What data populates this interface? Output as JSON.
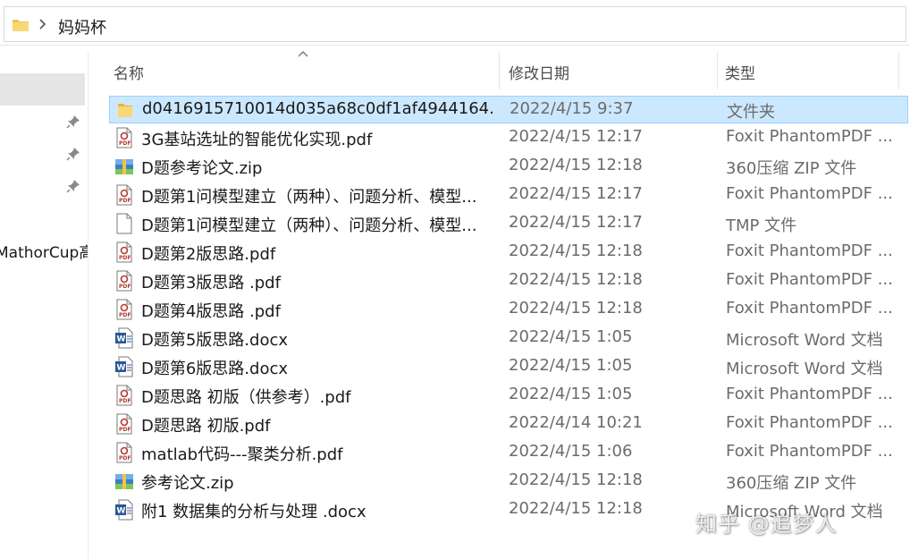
{
  "address": {
    "path": "妈妈杯"
  },
  "nav": {
    "partial_label": "MathorCup高"
  },
  "columns": {
    "name": "名称",
    "date": "修改日期",
    "type": "类型"
  },
  "files": [
    {
      "name": "d0416915710014d035a68c0df1af4944164...",
      "date": "2022/4/15 9:37",
      "type": "文件夹",
      "icon": "folder-icon",
      "selected": true
    },
    {
      "name": "3G基站选址的智能优化实现.pdf",
      "date": "2022/4/15 12:17",
      "type": "Foxit PhantomPDF ...",
      "icon": "pdf-icon"
    },
    {
      "name": "D题参考论文.zip",
      "date": "2022/4/15 12:18",
      "type": "360压缩 ZIP 文件",
      "icon": "zip-icon"
    },
    {
      "name": "D题第1问模型建立（两种）、问题分析、模型...",
      "date": "2022/4/15 12:17",
      "type": "Foxit PhantomPDF ...",
      "icon": "pdf-icon"
    },
    {
      "name": "D题第1问模型建立（两种）、问题分析、模型...",
      "date": "2022/4/15 12:17",
      "type": "TMP 文件",
      "icon": "blank-file-icon"
    },
    {
      "name": "D题第2版思路.pdf",
      "date": "2022/4/15 12:18",
      "type": "Foxit PhantomPDF ...",
      "icon": "pdf-icon"
    },
    {
      "name": "D题第3版思路 .pdf",
      "date": "2022/4/15 12:18",
      "type": "Foxit PhantomPDF ...",
      "icon": "pdf-icon"
    },
    {
      "name": "D题第4版思路 .pdf",
      "date": "2022/4/15 12:18",
      "type": "Foxit PhantomPDF ...",
      "icon": "pdf-icon"
    },
    {
      "name": "D题第5版思路.docx",
      "date": "2022/4/15 1:05",
      "type": "Microsoft Word 文档",
      "icon": "word-icon"
    },
    {
      "name": "D题第6版思路.docx",
      "date": "2022/4/15 1:05",
      "type": "Microsoft Word 文档",
      "icon": "word-icon"
    },
    {
      "name": "D题思路 初版（供参考）.pdf",
      "date": "2022/4/15 1:05",
      "type": "Foxit PhantomPDF ...",
      "icon": "pdf-icon"
    },
    {
      "name": "D题思路 初版.pdf",
      "date": "2022/4/14 10:21",
      "type": "Foxit PhantomPDF ...",
      "icon": "pdf-icon"
    },
    {
      "name": "matlab代码---聚类分析.pdf",
      "date": "2022/4/15 1:06",
      "type": "Foxit PhantomPDF ...",
      "icon": "pdf-icon"
    },
    {
      "name": "参考论文.zip",
      "date": "2022/4/15 12:18",
      "type": "360压缩 ZIP 文件",
      "icon": "zip-icon"
    },
    {
      "name": "附1 数据集的分析与处理 .docx",
      "date": "2022/4/15 12:18",
      "type": "Microsoft Word 文档",
      "icon": "word-icon"
    }
  ],
  "watermark": "知乎 @追梦人",
  "colors": {
    "selection_bg": "#cce8ff",
    "selection_border": "#99d1ff",
    "folder": "#f2c14e",
    "pdf": "#b5392f",
    "word": "#2b5797"
  }
}
